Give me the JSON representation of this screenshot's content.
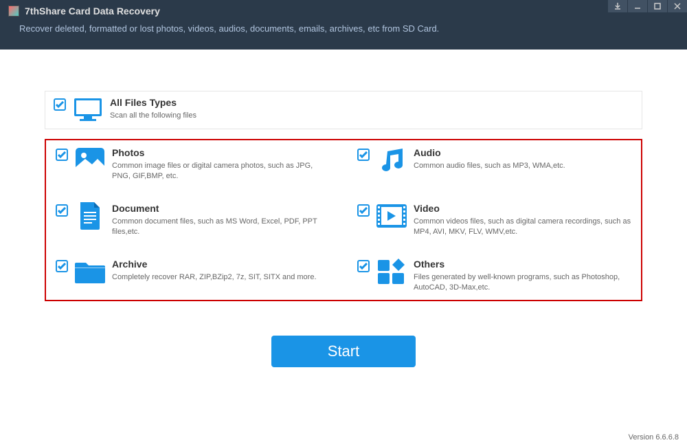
{
  "header": {
    "title": "7thShare Card Data Recovery",
    "subtitle": "Recover deleted, formatted or lost photos, videos, audios, documents, emails, archives, etc from SD Card."
  },
  "allFiles": {
    "title": "All Files Types",
    "desc": "Scan all the following files"
  },
  "items": [
    {
      "title": "Photos",
      "desc": "Common image files or digital camera photos, such as JPG, PNG, GIF,BMP, etc."
    },
    {
      "title": "Audio",
      "desc": "Common audio files, such as MP3, WMA,etc."
    },
    {
      "title": "Document",
      "desc": "Common document files, such as MS Word, Excel, PDF, PPT files,etc."
    },
    {
      "title": "Video",
      "desc": "Common videos files, such as digital camera recordings, such as MP4, AVI, MKV, FLV, WMV,etc."
    },
    {
      "title": "Archive",
      "desc": "Completely recover RAR, ZIP,BZip2, 7z, SIT, SITX and more."
    },
    {
      "title": "Others",
      "desc": "Files generated by well-known programs, such as Photoshop, AutoCAD, 3D-Max,etc."
    }
  ],
  "startButton": "Start",
  "version": "Version 6.6.6.8",
  "colors": {
    "accent": "#1a94e6"
  }
}
